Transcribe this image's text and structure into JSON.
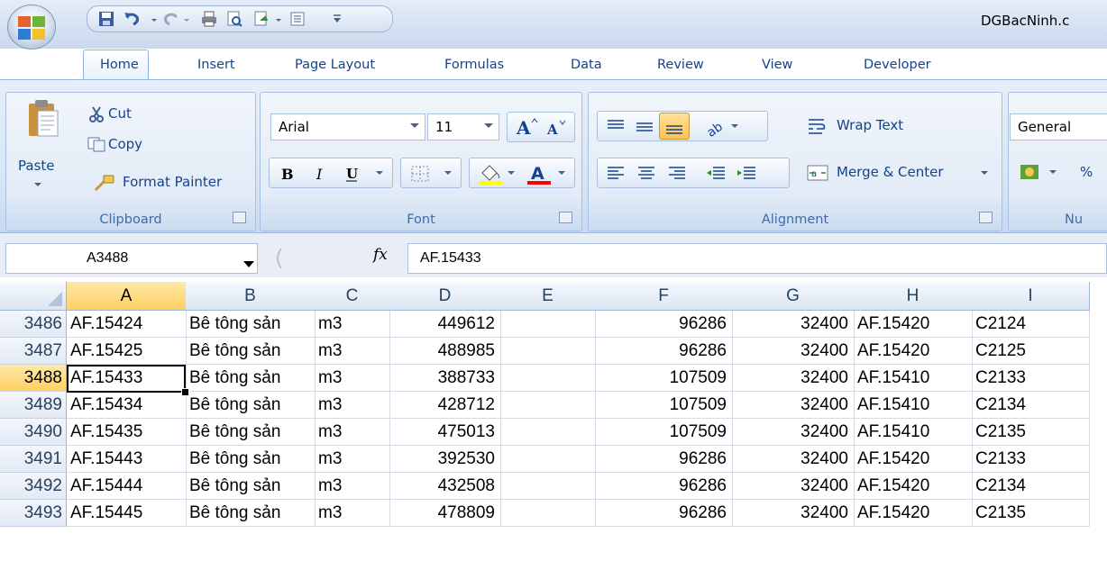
{
  "window": {
    "title": "DGBacNinh.c"
  },
  "ribbon_tabs": [
    "Home",
    "Insert",
    "Page Layout",
    "Formulas",
    "Data",
    "Review",
    "View",
    "Developer"
  ],
  "clipboard": {
    "paste": "Paste",
    "cut": "Cut",
    "copy": "Copy",
    "format_painter": "Format Painter",
    "label": "Clipboard"
  },
  "font": {
    "name": "Arial",
    "size": "11",
    "label": "Font"
  },
  "alignment": {
    "wrap_text": "Wrap Text",
    "merge_center": "Merge & Center",
    "label": "Alignment"
  },
  "number": {
    "format": "General",
    "label": "Nu",
    "percent": "%"
  },
  "formula_bar": {
    "name_box": "A3488",
    "fx": "fx",
    "formula": "AF.15433"
  },
  "columns": [
    "A",
    "B",
    "C",
    "D",
    "E",
    "F",
    "G",
    "H",
    "I"
  ],
  "rows": [
    {
      "num": "3486",
      "a": "AF.15424",
      "b": "Bê tông sản",
      "c": "m3",
      "d": "449612",
      "e": "",
      "f": "96286",
      "g": "32400",
      "h": "AF.15420",
      "i": "C2124"
    },
    {
      "num": "3487",
      "a": "AF.15425",
      "b": "Bê tông sản",
      "c": "m3",
      "d": "488985",
      "e": "",
      "f": "96286",
      "g": "32400",
      "h": "AF.15420",
      "i": "C2125"
    },
    {
      "num": "3488",
      "a": "AF.15433",
      "b": "Bê tông sản",
      "c": "m3",
      "d": "388733",
      "e": "",
      "f": "107509",
      "g": "32400",
      "h": "AF.15410",
      "i": "C2133"
    },
    {
      "num": "3489",
      "a": "AF.15434",
      "b": "Bê tông sản",
      "c": "m3",
      "d": "428712",
      "e": "",
      "f": "107509",
      "g": "32400",
      "h": "AF.15410",
      "i": "C2134"
    },
    {
      "num": "3490",
      "a": "AF.15435",
      "b": "Bê tông sản",
      "c": "m3",
      "d": "475013",
      "e": "",
      "f": "107509",
      "g": "32400",
      "h": "AF.15410",
      "i": "C2135"
    },
    {
      "num": "3491",
      "a": "AF.15443",
      "b": "Bê tông sản",
      "c": "m3",
      "d": "392530",
      "e": "",
      "f": "96286",
      "g": "32400",
      "h": "AF.15420",
      "i": "C2133"
    },
    {
      "num": "3492",
      "a": "AF.15444",
      "b": "Bê tông sản",
      "c": "m3",
      "d": "432508",
      "e": "",
      "f": "96286",
      "g": "32400",
      "h": "AF.15420",
      "i": "C2134"
    },
    {
      "num": "3493",
      "a": "AF.15445",
      "b": "Bê tông sản",
      "c": "m3",
      "d": "478809",
      "e": "",
      "f": "96286",
      "g": "32400",
      "h": "AF.15420",
      "i": "C2135"
    }
  ],
  "selection": {
    "column": "A",
    "row": "3488"
  },
  "colors": {
    "ribbon_text": "#15428b",
    "selected_header": "#ffcf64",
    "fill_highlight": "#ffff00",
    "font_color": "#ff0000"
  }
}
